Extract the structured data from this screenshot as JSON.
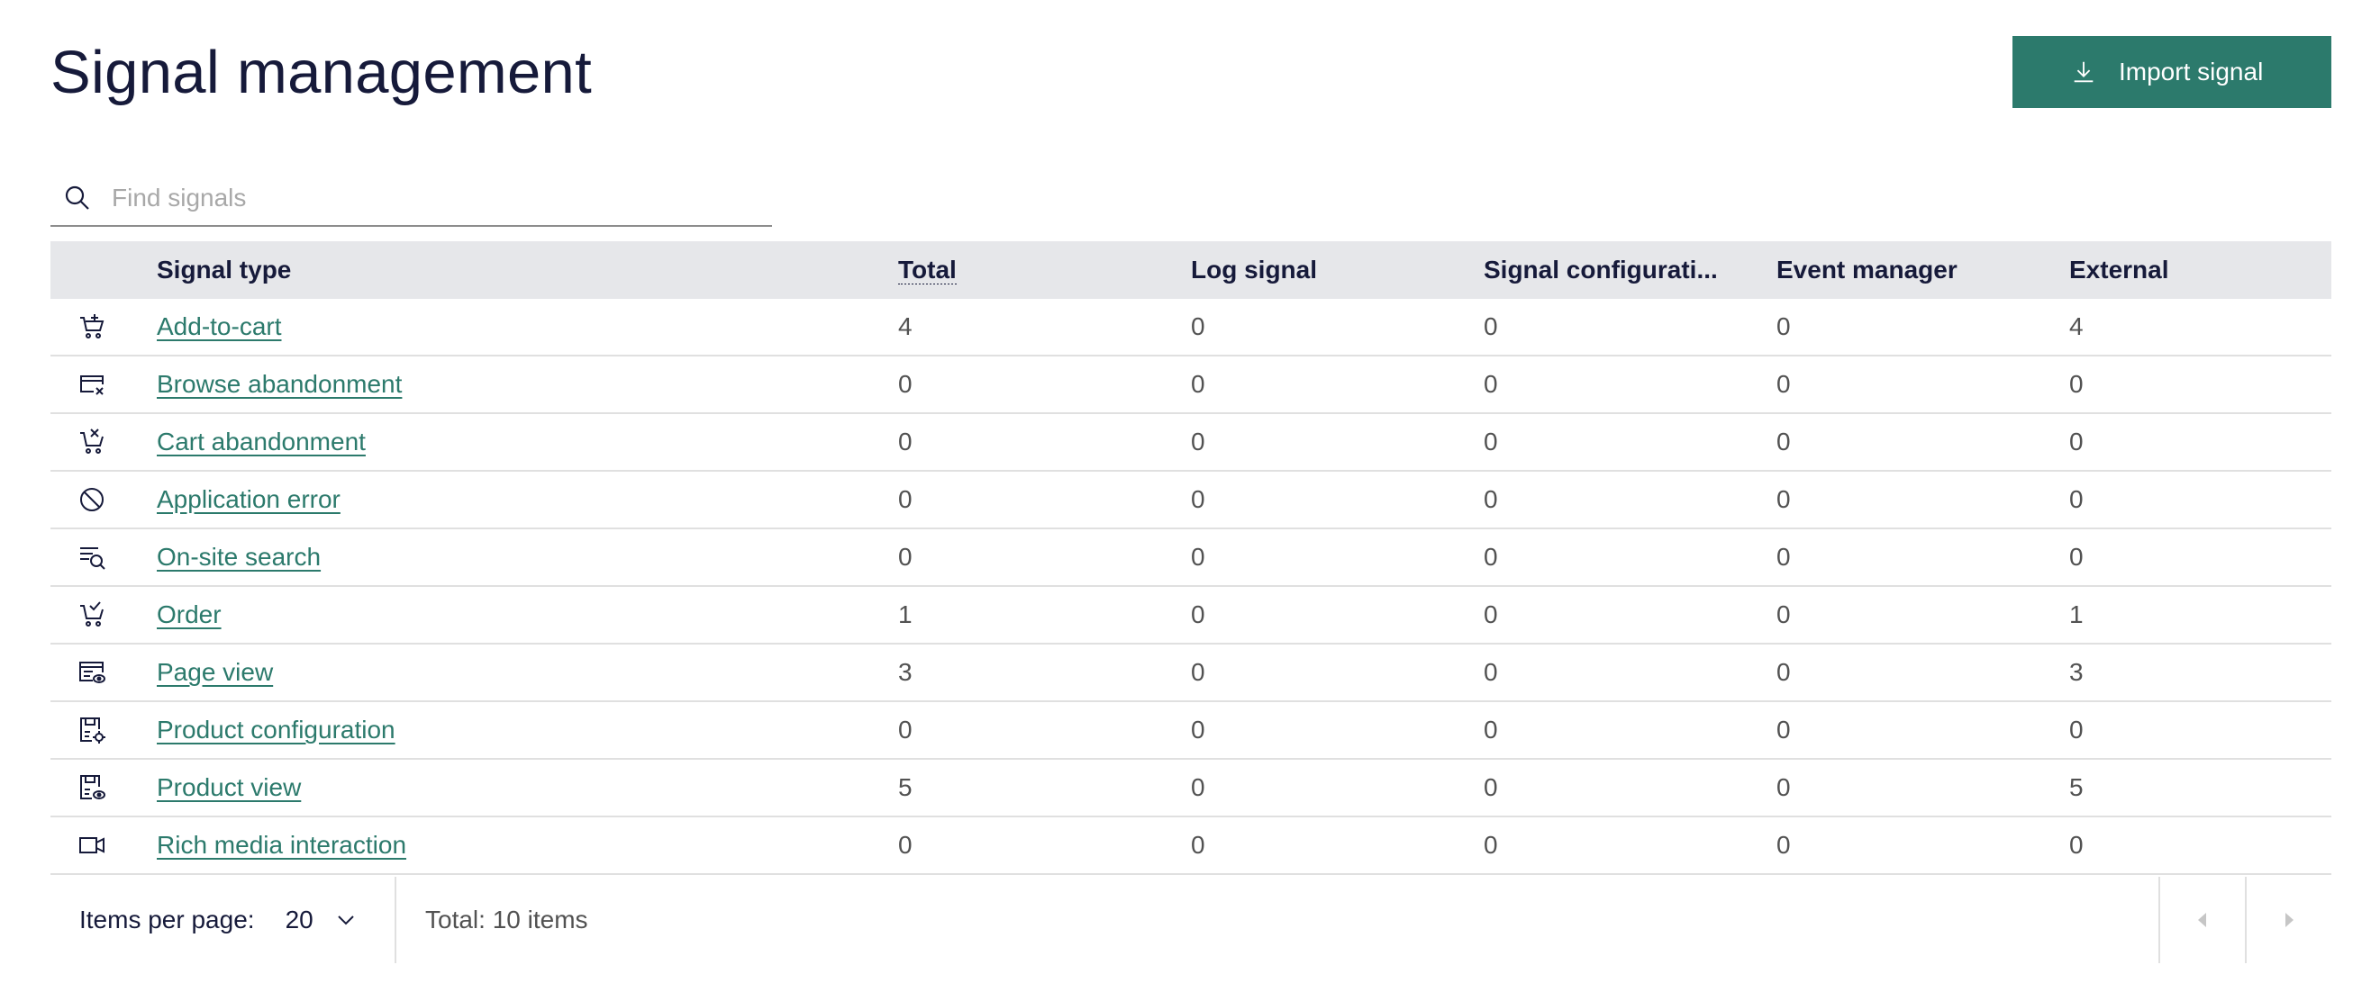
{
  "header": {
    "title": "Signal management",
    "import_label": "Import signal"
  },
  "search": {
    "placeholder": "Find signals",
    "value": ""
  },
  "table": {
    "columns": [
      "Signal type",
      "Total",
      "Log signal",
      "Signal configurati...",
      "Event manager",
      "External"
    ],
    "rows": [
      {
        "icon": "cart-add-icon",
        "type": "Add-to-cart",
        "total": "4",
        "log": "0",
        "config": "0",
        "event": "0",
        "external": "4"
      },
      {
        "icon": "browse-abandon-icon",
        "type": "Browse abandonment",
        "total": "0",
        "log": "0",
        "config": "0",
        "event": "0",
        "external": "0"
      },
      {
        "icon": "cart-remove-icon",
        "type": "Cart abandonment",
        "total": "0",
        "log": "0",
        "config": "0",
        "event": "0",
        "external": "0"
      },
      {
        "icon": "blocked-icon",
        "type": "Application error",
        "total": "0",
        "log": "0",
        "config": "0",
        "event": "0",
        "external": "0"
      },
      {
        "icon": "list-search-icon",
        "type": "On-site search",
        "total": "0",
        "log": "0",
        "config": "0",
        "event": "0",
        "external": "0"
      },
      {
        "icon": "cart-check-icon",
        "type": "Order",
        "total": "1",
        "log": "0",
        "config": "0",
        "event": "0",
        "external": "1"
      },
      {
        "icon": "page-view-icon",
        "type": "Page view",
        "total": "3",
        "log": "0",
        "config": "0",
        "event": "0",
        "external": "3"
      },
      {
        "icon": "product-config-icon",
        "type": "Product configuration",
        "total": "0",
        "log": "0",
        "config": "0",
        "event": "0",
        "external": "0"
      },
      {
        "icon": "product-view-icon",
        "type": "Product view",
        "total": "5",
        "log": "0",
        "config": "0",
        "event": "0",
        "external": "5"
      },
      {
        "icon": "video-icon",
        "type": "Rich media interaction",
        "total": "0",
        "log": "0",
        "config": "0",
        "event": "0",
        "external": "0"
      }
    ]
  },
  "pagination": {
    "items_per_page_label": "Items per page:",
    "items_per_page_value": "20",
    "total_label": "Total: 10 items"
  },
  "colors": {
    "accent": "#2c7a6c",
    "header_bg": "#e6e7ea",
    "title": "#161a3a"
  }
}
